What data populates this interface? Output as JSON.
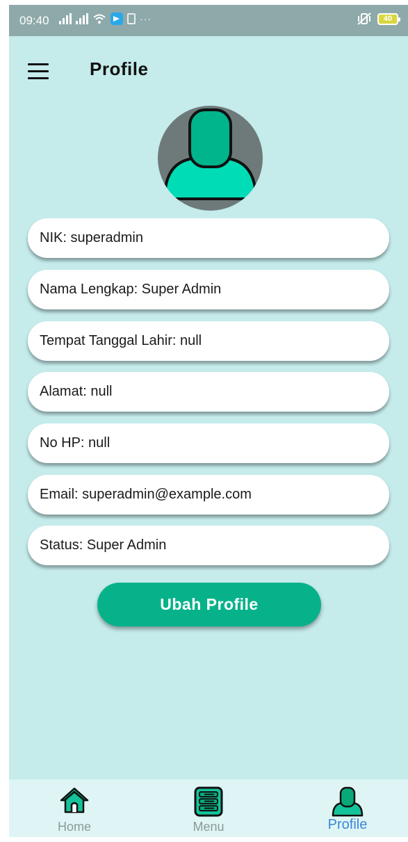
{
  "status_bar": {
    "time": "09:40",
    "battery": "40",
    "overflow": "···"
  },
  "app_bar": {
    "title": "Profile"
  },
  "profile_fields": [
    {
      "text": "NIK: superadmin"
    },
    {
      "text": "Nama Lengkap: Super Admin"
    },
    {
      "text": "Tempat Tanggal Lahir: null"
    },
    {
      "text": "Alamat: null"
    },
    {
      "text": "No HP: null"
    },
    {
      "text": "Email: superadmin@example.com"
    },
    {
      "text": "Status: Super Admin"
    }
  ],
  "actions": {
    "edit_label": "Ubah Profile"
  },
  "bottom_nav": {
    "items": [
      {
        "label": "Home",
        "icon": "home-icon"
      },
      {
        "label": "Menu",
        "icon": "menu-list-icon"
      },
      {
        "label": "Profile",
        "icon": "profile-icon",
        "active": true
      }
    ]
  },
  "colors": {
    "background": "#c5ebeb",
    "accent": "#07b28a",
    "avatar_body": "#00dcb6",
    "active_nav": "#3a86d9",
    "inactive_nav": "#8a9a9a"
  }
}
